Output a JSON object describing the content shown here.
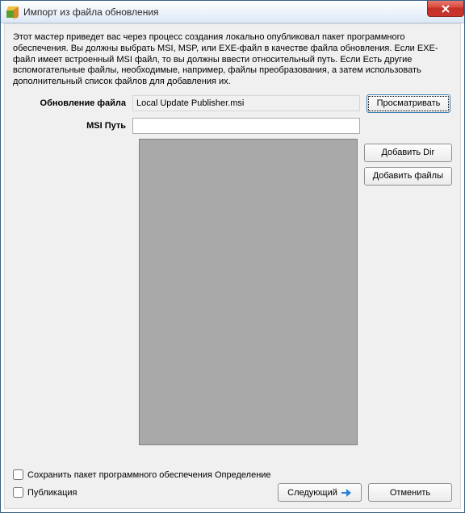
{
  "window": {
    "title": "Импорт из файла обновления",
    "icon": "package-icon"
  },
  "intro": "Этот мастер приведет вас через процесс создания локально опубликовал пакет программного обеспечения. Вы должны выбрать MSI, MSP, или EXE-файл в качестве файла обновления. Если EXE-файл имеет встроенный MSI файл, то вы должны ввести относительный путь. Если Есть другие вспомогательные файлы, необходимые, например, файлы преобразования, а затем использовать дополнительный список файлов для добавления их.",
  "labels": {
    "updateFile": "Обновление файла",
    "msiPath": "MSI Путь"
  },
  "fields": {
    "updateFile": "Local Update Publisher.msi",
    "msiPath": ""
  },
  "buttons": {
    "browse": "Просматривать",
    "addDir": "Добавить Dir",
    "addFiles": "Добавить файлы",
    "next": "Следующий",
    "cancel": "Отменить"
  },
  "checkboxes": {
    "saveDef": "Сохранить пакет программного обеспечения Определение",
    "publish": "Публикация"
  }
}
